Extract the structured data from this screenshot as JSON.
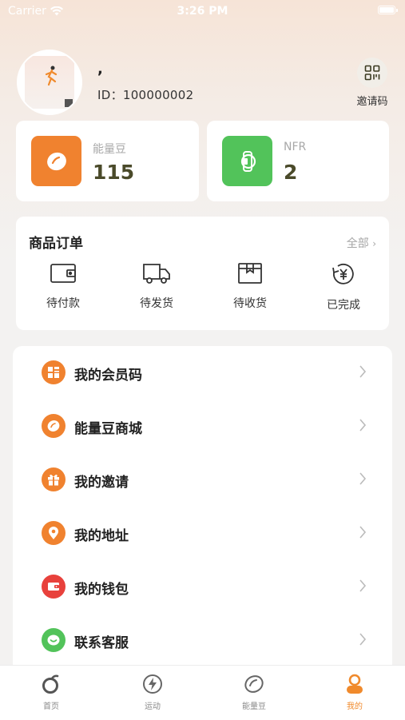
{
  "status_bar": {
    "carrier": "Carrier",
    "time": "3:26 PM"
  },
  "profile": {
    "nickname": ",",
    "id_text": "ID：100000002"
  },
  "invite": {
    "label": "邀请码",
    "icon": "qr-code-icon"
  },
  "stats": [
    {
      "name": "能量豆",
      "value": "115",
      "icon": "bean-icon",
      "color": "#f0822f"
    },
    {
      "name": "NFR",
      "value": "2",
      "icon": "watch-icon",
      "color": "#52c35a"
    }
  ],
  "orders": {
    "title": "商品订单",
    "all_label": "全部",
    "items": [
      {
        "label": "待付款",
        "icon": "wallet-icon"
      },
      {
        "label": "待发货",
        "icon": "truck-icon"
      },
      {
        "label": "待收货",
        "icon": "package-icon"
      },
      {
        "label": "已完成",
        "icon": "yen-refresh-icon"
      }
    ]
  },
  "menu": [
    {
      "label": "我的会员码",
      "icon": "member-code-icon",
      "color": "#f0822f"
    },
    {
      "label": "能量豆商城",
      "icon": "bean-icon",
      "color": "#f0822f"
    },
    {
      "label": "我的邀请",
      "icon": "gift-icon",
      "color": "#f0822f"
    },
    {
      "label": "我的地址",
      "icon": "location-pin-icon",
      "color": "#f0822f"
    },
    {
      "label": "我的钱包",
      "icon": "wallet-icon",
      "color": "#e8413c"
    },
    {
      "label": "联系客服",
      "icon": "chat-icon",
      "color": "#52c35a"
    }
  ],
  "tabs": [
    {
      "label": "首页",
      "icon": "home-bean-icon"
    },
    {
      "label": "运动",
      "icon": "lightning-icon"
    },
    {
      "label": "能量豆",
      "icon": "bean-icon"
    },
    {
      "label": "我的",
      "icon": "profile-icon",
      "active": true
    }
  ],
  "accent_color": "#f08a2c"
}
